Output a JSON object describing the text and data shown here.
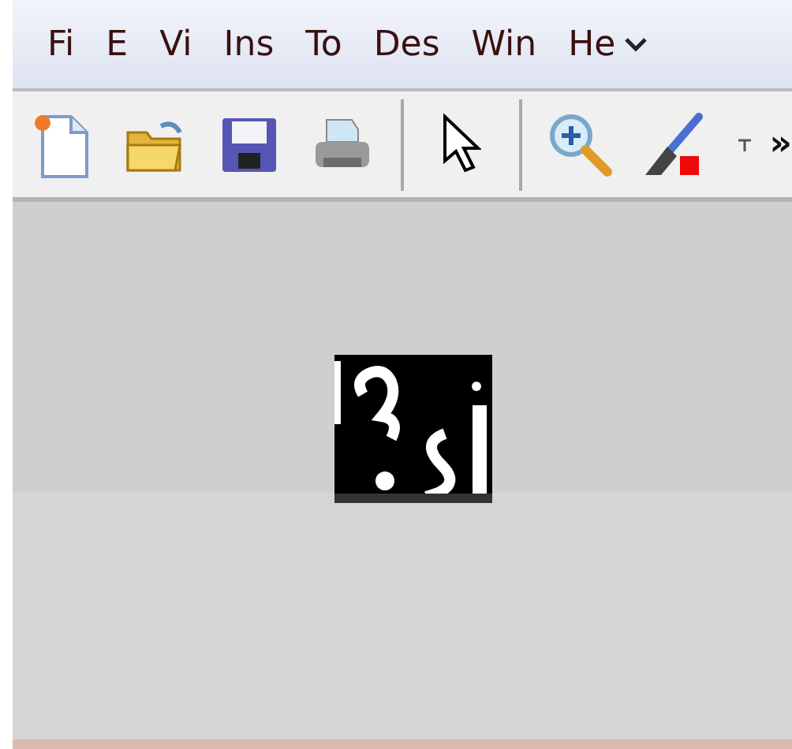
{
  "menu_bar": {
    "items": [
      "Fi",
      "E",
      "Vi",
      "Ins",
      "To",
      "Des",
      "Win",
      "He"
    ]
  },
  "toolbar": {
    "tools": [
      {
        "kind": "new"
      },
      {
        "kind": "open"
      },
      {
        "kind": "save"
      },
      {
        "kind": "print"
      },
      {
        "kind": "separator"
      },
      {
        "kind": "pointer"
      },
      {
        "kind": "separator"
      },
      {
        "kind": "zoom"
      },
      {
        "kind": "brush"
      },
      {
        "kind": "caret"
      },
      {
        "kind": "more",
        "label": "»"
      }
    ]
  }
}
